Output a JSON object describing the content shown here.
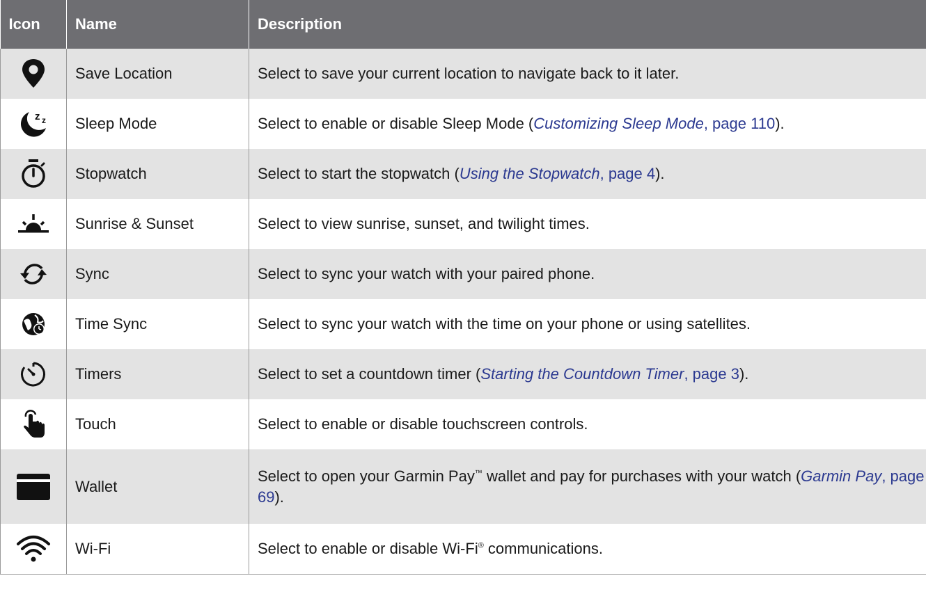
{
  "header": {
    "icon": "Icon",
    "name": "Name",
    "description": "Description"
  },
  "rows": [
    {
      "icon": "location-pin-icon",
      "name": "Save Location",
      "desc": "Select to save your current location to navigate back to it later."
    },
    {
      "icon": "sleep-moon-icon",
      "name": "Sleep Mode",
      "desc_pre": "Select to enable or disable Sleep Mode (",
      "xref_title": "Customizing Sleep Mode",
      "xref_page": ", page 110",
      "desc_post": ")."
    },
    {
      "icon": "stopwatch-icon",
      "name": "Stopwatch",
      "desc_pre": "Select to start the stopwatch (",
      "xref_title": "Using the Stopwatch",
      "xref_page": ", page 4",
      "desc_post": ")."
    },
    {
      "icon": "sunrise-icon",
      "name": "Sunrise & Sunset",
      "desc": "Select to view sunrise, sunset, and twilight times."
    },
    {
      "icon": "sync-arrows-icon",
      "name": "Sync",
      "desc": "Select to sync your watch with your paired phone."
    },
    {
      "icon": "globe-clock-icon",
      "name": "Time Sync",
      "desc": "Select to sync your watch with the time on your phone or using satellites."
    },
    {
      "icon": "timer-icon",
      "name": "Timers",
      "desc_pre": "Select to set a countdown timer (",
      "xref_title": "Starting the Countdown Timer",
      "xref_page": ", page 3",
      "desc_post": ")."
    },
    {
      "icon": "touch-hand-icon",
      "name": "Touch",
      "desc": "Select to enable or disable touchscreen controls."
    },
    {
      "icon": "wallet-card-icon",
      "name": "Wallet",
      "desc_pre": "Select to open your Garmin Pay",
      "desc_tm": "™",
      "desc_mid": " wallet and pay for purchases with your watch (",
      "xref_title": "Garmin Pay",
      "xref_page": ", page 69",
      "desc_post": ")."
    },
    {
      "icon": "wifi-icon",
      "name": "Wi-Fi",
      "desc_pre": "Select to enable or disable Wi-Fi",
      "desc_reg": "®",
      "desc_post": " communications."
    }
  ],
  "colors": {
    "header_bg": "#6e6e72",
    "row_shade": "#e3e3e3",
    "link": "#2b3990"
  }
}
